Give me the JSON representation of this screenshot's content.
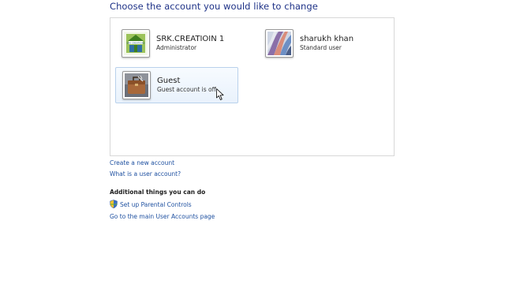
{
  "heading": "Choose the account you would like to change",
  "accounts": [
    {
      "name": "SRK.CREATIOIN 1",
      "role": "Administrator",
      "picture_icon": "green-building-logo-icon",
      "picture_caption": "SRK CREATIONS"
    },
    {
      "name": "sharukh khan",
      "role": "Standard user",
      "picture_icon": "fabric-folds-icon"
    },
    {
      "name": "Guest",
      "role": "Guest account is off",
      "picture_icon": "briefcase-icon",
      "selected": true
    }
  ],
  "links": {
    "create_account": "Create a new account",
    "what_is_account": "What is a user account?"
  },
  "additional": {
    "title": "Additional things you can do",
    "parental_controls": "Set up Parental Controls",
    "main_page": "Go to the main User Accounts page"
  },
  "colors": {
    "heading": "#1e3287",
    "link": "#1e50a0",
    "selection_border": "#b9d1ec"
  }
}
